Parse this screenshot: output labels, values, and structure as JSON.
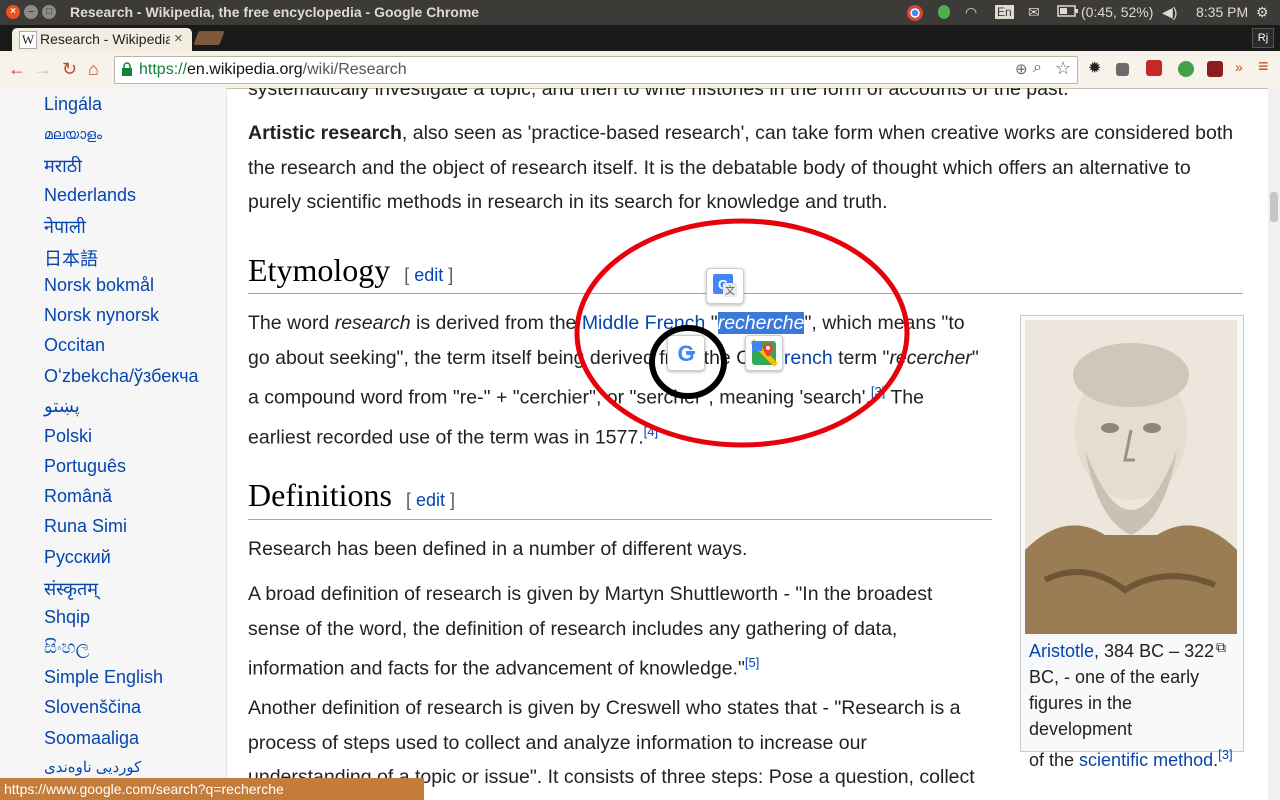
{
  "window": {
    "title": "Research - Wikipedia, the free encyclopedia - Google Chrome",
    "tray": {
      "keyboard": "En",
      "battery": "(0:45, 52%)",
      "clock": "8:35 PM"
    }
  },
  "tabs": [
    {
      "label": "Research - Wikipedia",
      "favicon": "W"
    }
  ],
  "profile": "Rj",
  "address_bar": {
    "scheme": "https://",
    "host": "en.wikipedia.org",
    "path": "/wiki/Research"
  },
  "sidebar": {
    "languages": [
      "Lingála",
      "മലയാളം",
      "मराठी",
      "Nederlands",
      "नेपाली",
      "日本語",
      "Norsk bokmål",
      "Norsk nynorsk",
      "Occitan",
      "Oʻzbekcha/ўзбекча",
      "پښتو",
      "Polski",
      "Português",
      "Română",
      "Runa Simi",
      "Русский",
      "संस्कृतम्",
      "Shqip",
      "සිංහල",
      "Simple English",
      "Slovenščina",
      "Soomaaliga",
      "کوردیی ناوەندی"
    ]
  },
  "article": {
    "top_cut": "systematically investigate a topic, and then to write histories in the form of accounts of the past.",
    "artistic": {
      "term": "Artistic research",
      "l1": ", also seen as 'practice-based research', can take form when creative works are considered both",
      "l2": "the research and the object of research itself. It is the debatable body of thought which offers an alternative to",
      "l3": "purely scientific methods in research in its search for knowledge and truth."
    },
    "etymology": {
      "heading": "Etymology",
      "edit": "edit",
      "l1a": "The word ",
      "l1b": "research",
      "l1c": " is derived from the ",
      "l1link": "Middle French",
      "l1d": " \"",
      "l1sel": "recherche",
      "l1e": "\", which means \"to",
      "l2a": "go about seeking\", the term itself being derived from the Old ",
      "l2link": "French",
      "l2b": " term \"",
      "l2it": "recercher",
      "l2c": "\"",
      "l3a": "a compound word from \"re-\" + \"cerchier\", or \"sercher\", meaning 'search'.",
      "l3ref": "[3]",
      "l3b": " The",
      "l4a": "earliest recorded use of the term was in 1577.",
      "l4ref": "[4]"
    },
    "definitions": {
      "heading": "Definitions",
      "edit": "edit",
      "p1": "Research has been defined in a number of different ways.",
      "p2l1": "A broad definition of research is given by Martyn Shuttleworth - \"In the broadest",
      "p2l2": "sense of the word, the definition of research includes any gathering of data,",
      "p2l3": "information and facts for the advancement of knowledge.\"",
      "p2ref": "[5]",
      "p3l1": "Another definition of research is given by Creswell who states that - \"Research is a",
      "p3l2": "process of steps used to collect and analyze information to increase our",
      "p3l3": "understanding of a topic or issue\". It consists of three steps: Pose a question, collect"
    },
    "infobox": {
      "caption_link": "Aristotle",
      "caption_l1": ", 384 BC – 322",
      "caption_l2": "BC, - one of the early",
      "caption_l3": "figures in the development",
      "caption_l4a": "of the ",
      "caption_link2": "scientific method",
      "caption_l4b": ".",
      "caption_ref": "[3]"
    }
  },
  "status_url": "https://www.google.com/search?q=recherche",
  "colors": {
    "link": "#0645ad",
    "annotation_red": "#e8000b",
    "annotation_black": "#000000",
    "selection": "#3b78d8"
  }
}
